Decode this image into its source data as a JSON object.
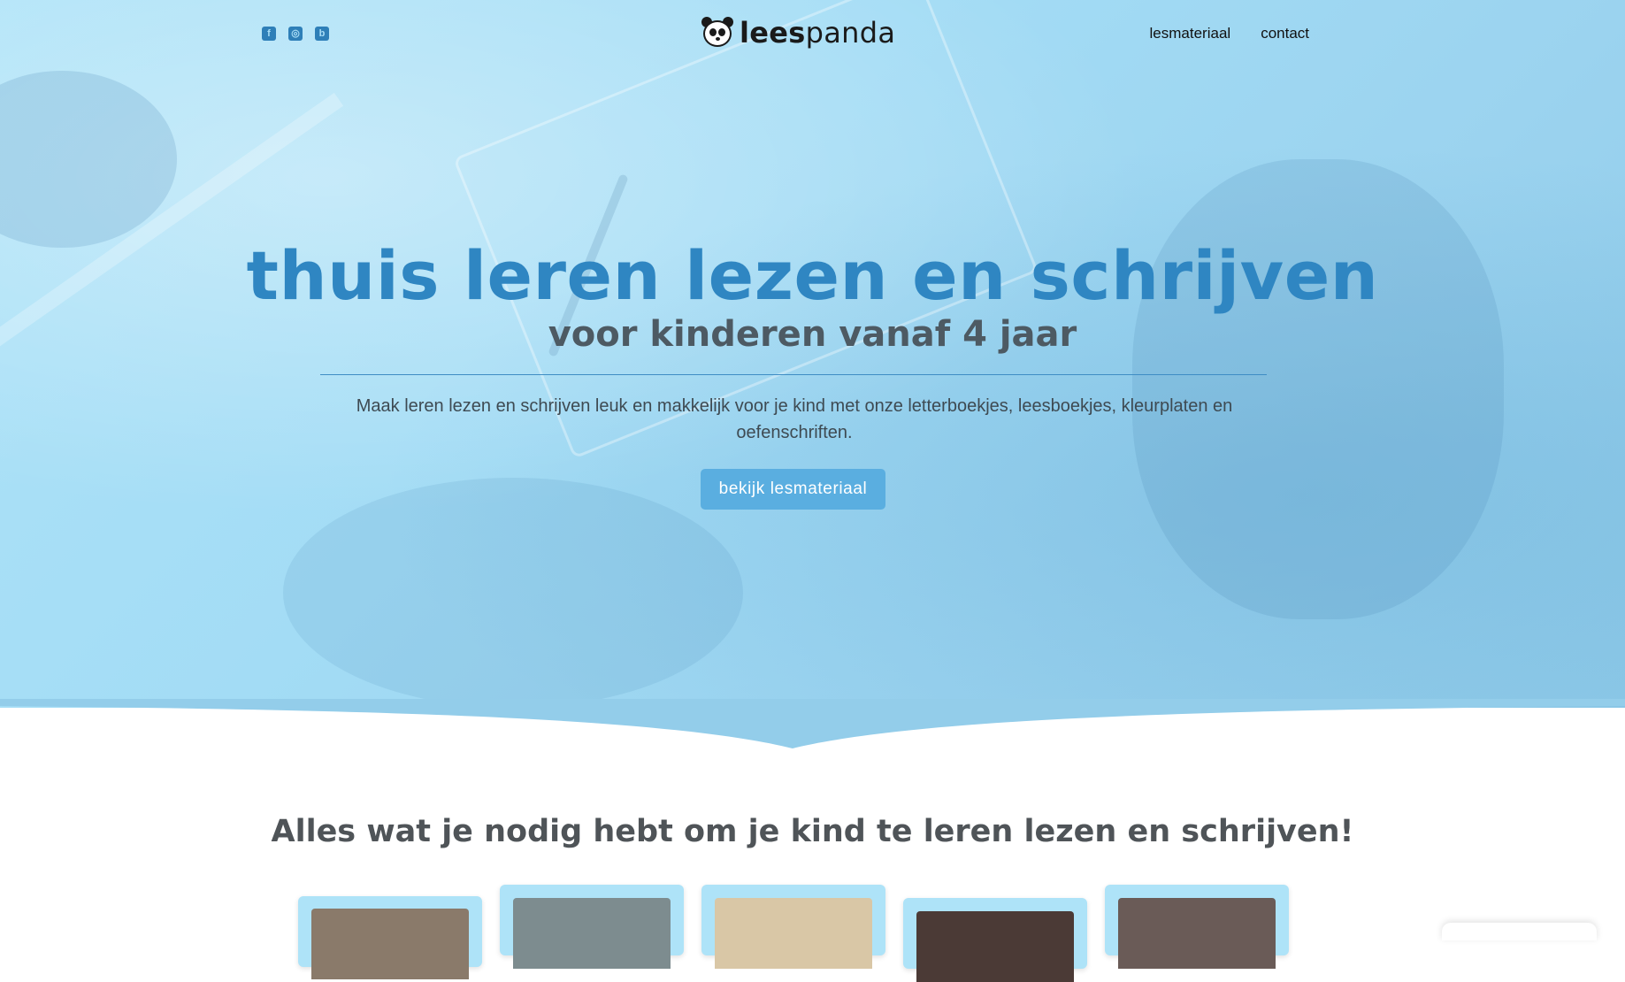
{
  "header": {
    "social": [
      {
        "name": "facebook",
        "glyph": "f"
      },
      {
        "name": "instagram",
        "glyph": "◎"
      },
      {
        "name": "blog",
        "glyph": "b"
      }
    ],
    "logo": {
      "part1": "lees",
      "part2": "panda"
    },
    "nav": [
      {
        "label": "lesmateriaal"
      },
      {
        "label": "contact"
      }
    ]
  },
  "hero": {
    "title": "thuis leren lezen en schrijven",
    "subtitle": "voor kinderen vanaf 4 jaar",
    "intro": "Maak leren lezen en schrijven leuk en makkelijk voor je kind met onze letterboekjes, leesboekjes, kleurplaten en oefenschriften.",
    "cta": "bekijk lesmateriaal"
  },
  "section": {
    "title": "Alles wat je nodig hebt om je kind te leren lezen en schrijven!"
  },
  "cards": [
    {
      "name": "card-1",
      "color": "#8a7a6a"
    },
    {
      "name": "card-2",
      "color": "#7d8c8f"
    },
    {
      "name": "card-3",
      "color": "#d9c7a6"
    },
    {
      "name": "card-4",
      "color": "#4b3a36"
    },
    {
      "name": "card-5",
      "color": "#6a5b57"
    }
  ],
  "colors": {
    "accent": "#2f86c2",
    "button": "#5aaee0",
    "hero_bg": "#a3dcf5"
  }
}
